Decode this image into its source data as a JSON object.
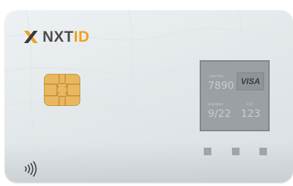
{
  "card": {
    "brand": {
      "prefix": "NXT",
      "suffix": "ID"
    },
    "last_four_label": "Last Four",
    "last_four": "7890",
    "network": "VISA",
    "expiration_label": "Expiration",
    "expiration": "9/22",
    "cvc_label": "CVC",
    "cvc": "123"
  },
  "icons": {
    "logo": "nxtid-x-mark",
    "chip": "emv-chip-icon",
    "contactless": "contactless-icon"
  },
  "colors": {
    "card_background": "#e6eaed",
    "panel": "#9aa0a3",
    "accent_orange": "#f0a020",
    "brand_text": "#4c4c4c",
    "chip_gold": "#e8b860"
  }
}
